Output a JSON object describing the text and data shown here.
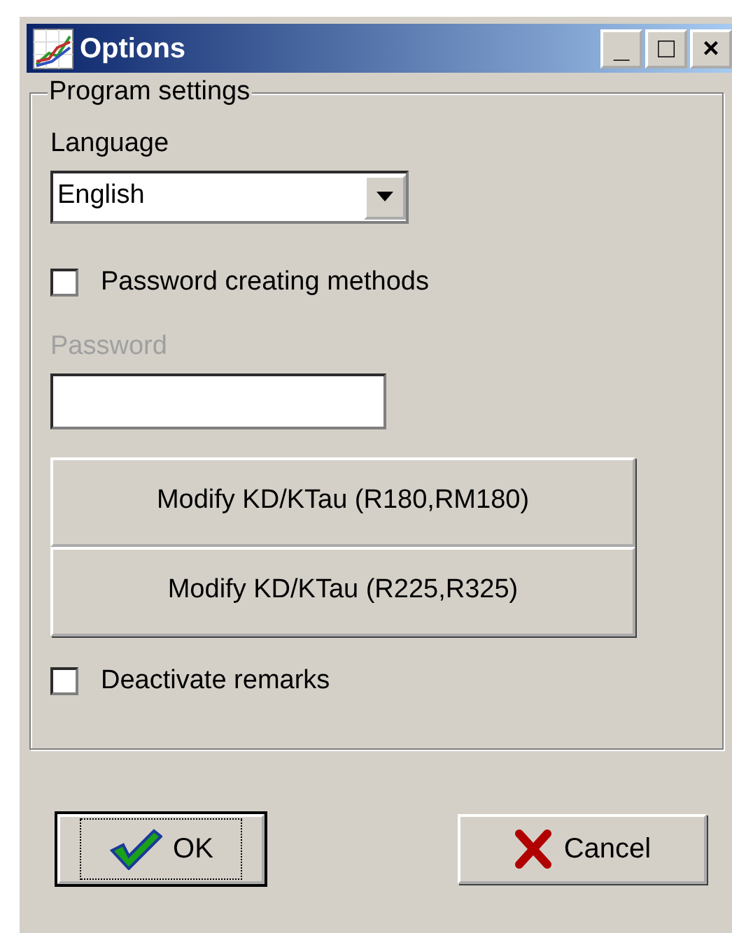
{
  "window": {
    "title": "Options",
    "controls": [
      "_",
      "□",
      "×"
    ]
  },
  "group": {
    "title": "Program settings",
    "language": {
      "label": "Language",
      "value": "English"
    },
    "password_methods": {
      "label": "Password creating methods",
      "checked": false
    },
    "password": {
      "label": "Password",
      "disabled": true
    },
    "buttons": [
      "Modify KD/KTau (R180,RM180)",
      "Modify KD/KTau (R225,R325)"
    ],
    "deactivate_remarks": {
      "label": "Deactivate remarks",
      "checked": false
    }
  },
  "footer": [
    {
      "label": "OK",
      "kind": "ok",
      "focused": true
    },
    {
      "label": "Cancel",
      "kind": "cancel",
      "focused": false
    }
  ]
}
